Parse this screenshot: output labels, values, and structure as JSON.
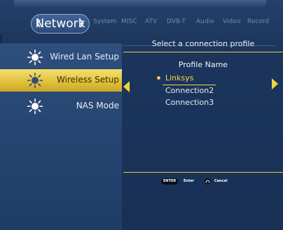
{
  "tabs": {
    "active": "Network",
    "others": [
      "System",
      "MISC",
      "ATV",
      "DVB-T",
      "Audio",
      "Video",
      "Record"
    ]
  },
  "menu": {
    "items": [
      {
        "label": "Wired Lan Setup"
      },
      {
        "label": "Wireless Setup"
      },
      {
        "label": "NAS Mode"
      }
    ]
  },
  "content": {
    "title": "Select a connection profile",
    "profile_header": "Profile Name",
    "profiles": [
      "Linksys",
      "Connection2",
      "Connection3"
    ]
  },
  "hints": {
    "enter_key": "ENTER",
    "enter_label": "Enter",
    "cancel_label": "Cancel"
  },
  "colors": {
    "accent": "#f2d43a",
    "background": "#1c355c",
    "selected_bar": "#e2c23c"
  },
  "icons": [
    "sun-icon",
    "chevron-left-icon",
    "chevron-right-icon",
    "arrow-left-icon",
    "arrow-right-icon",
    "return-icon"
  ]
}
